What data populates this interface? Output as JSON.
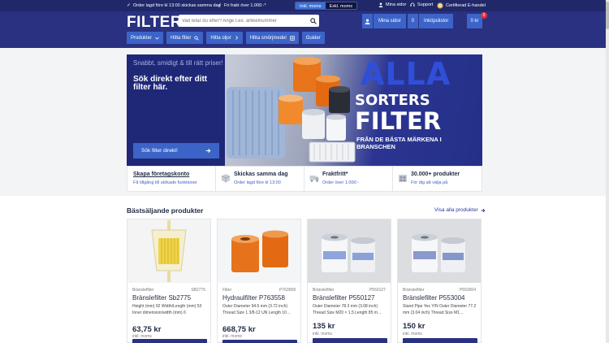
{
  "topbar": {
    "order_promo": "Order lagd före kl 13:00 skickas samma dag",
    "freight_promo": "Fri frakt över 1.000:-*",
    "vat_incl": "Inkl. moms",
    "vat_excl": "Exkl. moms",
    "my_pages": "Mina sidor",
    "support": "Support",
    "certified": "Certifierad E-handel"
  },
  "header": {
    "logo": "FILTER",
    "logo_suffix": ".se",
    "search_placeholder": "Vad letar du efter? Ange t.ex. artikelnummer",
    "my_pages": "Mina sidor",
    "basket_count": "0",
    "basket_label": "Inköpslistor",
    "cart_total": "0 kr",
    "cart_badge": "0"
  },
  "nav": [
    {
      "label": "Produkter",
      "icon": "chevron-down-icon"
    },
    {
      "label": "Hitta filter",
      "icon": "search-filter-icon"
    },
    {
      "label": "Hitta oljor",
      "icon": "chevron-right-icon"
    },
    {
      "label": "Hitta smörjmedel",
      "icon": "grid-icon"
    },
    {
      "label": "Guider",
      "icon": ""
    }
  ],
  "hero": {
    "tagline": "Snabbt, smidigt & till rätt priser!",
    "title": "Sök direkt efter ditt filter här.",
    "button": "Sök filter direkt!",
    "banner_line1": "ALLA",
    "banner_line2": "SORTERS",
    "banner_line3": "FILTER",
    "banner_line4": "FRÅN DE BÄSTA MÄRKENA I BRANSCHEN"
  },
  "usps": [
    {
      "title": "Skapa företagskonto",
      "sub": "Få tillgång till utökade funktioner",
      "icon": ""
    },
    {
      "title": "Skickas samma dag",
      "sub": "Order lagd före kl 13:00",
      "icon": "box-icon"
    },
    {
      "title": "Fraktfritt*",
      "sub": "Order över 1.000:-",
      "icon": "truck-icon"
    },
    {
      "title": "30.000+ produkter",
      "sub": "För dig att välja på",
      "icon": "warehouse-icon"
    }
  ],
  "section": {
    "title": "Bästsäljande produkter",
    "see_all": "Visa alla produkter"
  },
  "products": [
    {
      "category": "Bränslefilter",
      "sku": "SB2775",
      "name": "Bränslefilter Sb2775",
      "desc": "Height (mm) 92 Width/Length (mm) 53 Inner dimension/width (mm) 6",
      "price": "63,75 kr",
      "vat": "inkl. moms"
    },
    {
      "category": "Filter",
      "sku": "P763558",
      "name": "Hydraulfilter P763558",
      "desc": "Outer Diameter 94.6 mm (3.72 inch) Thread Size 1 3/8-12 UN Length 10…",
      "price": "668,75 kr",
      "vat": "inkl. moms"
    },
    {
      "category": "Bränslefilter",
      "sku": "P550127",
      "name": "Bränslefilter P550127",
      "desc": "Outer Diameter 78.3 mm (3.08 inch) Thread Size M20 × 1.5 Length 85 m…",
      "price": "135 kr",
      "vat": "inkl. moms"
    },
    {
      "category": "Bränslefilter",
      "sku": "P553004",
      "name": "Bränslefilter P553004",
      "desc": "Stand Pipe Yes Y/N Outer Diameter 77.2 mm (3.04 inch) Thread Size M1…",
      "price": "150 kr",
      "vat": "inkl. moms"
    }
  ],
  "colors": {
    "navy": "#2a3180",
    "accent_blue": "#3c64c8",
    "badge_red": "#e0303a"
  }
}
